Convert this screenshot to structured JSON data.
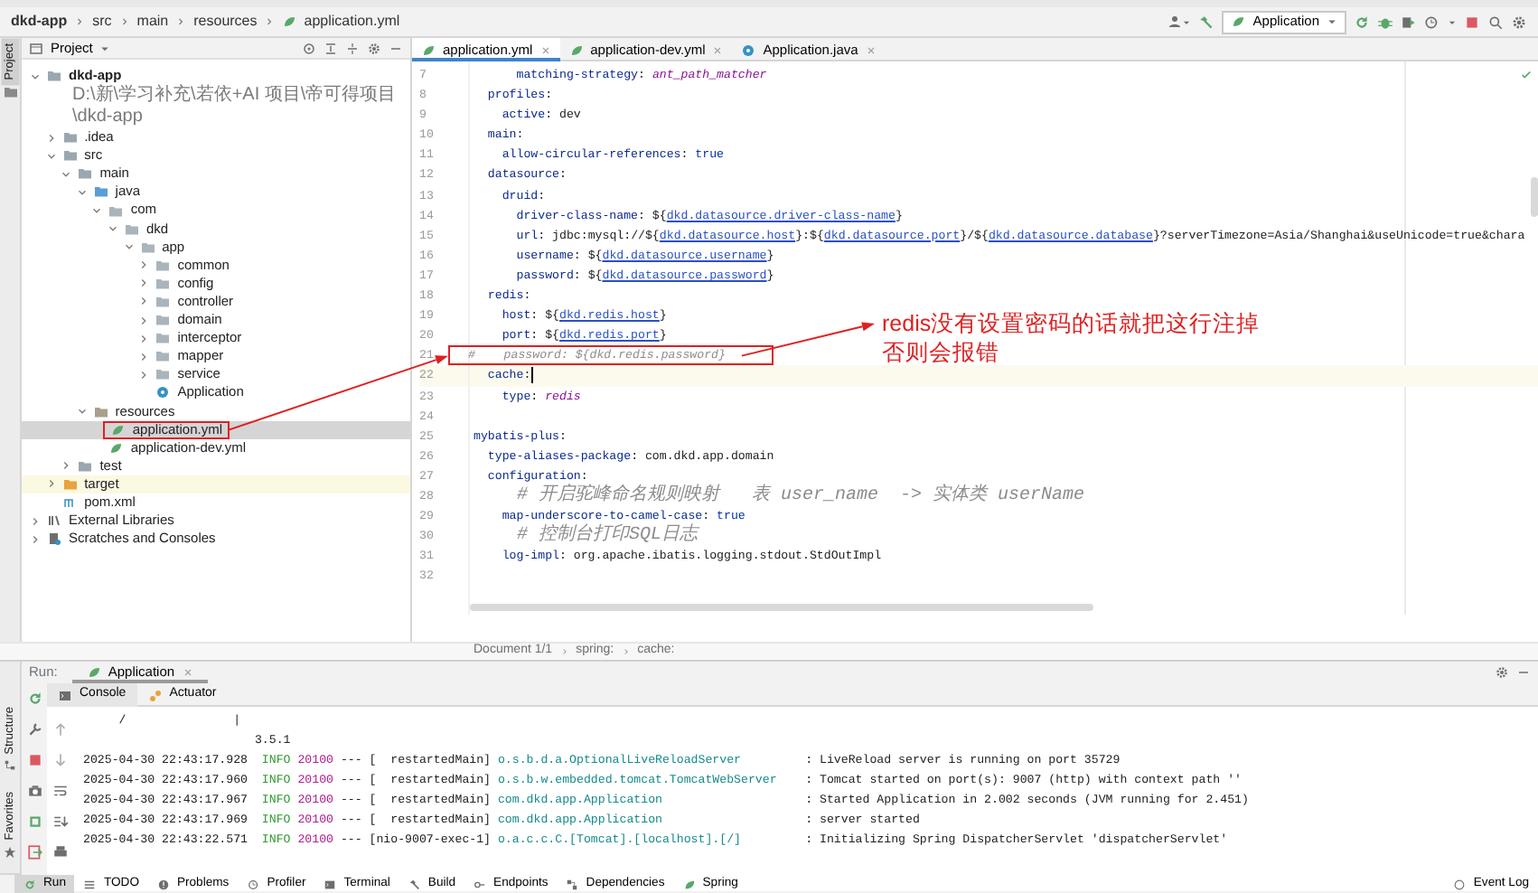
{
  "breadcrumb": [
    "dkd-app",
    "src",
    "main",
    "resources",
    "application.yml"
  ],
  "run_config": {
    "label": "Application"
  },
  "side_tabs": {
    "top": [
      {
        "label": "Project",
        "selected": true
      }
    ],
    "bottom": [
      {
        "label": "Structure",
        "selected": false
      },
      {
        "label": "Favorites",
        "selected": false
      }
    ]
  },
  "project_panel": {
    "title": "Project",
    "tree": [
      {
        "label": "dkd-app",
        "kind": "module",
        "path": "D:\\新\\学习补充\\若依+AI 项目\\帝可得项目\\dkd-app",
        "expanded": true,
        "selected": false,
        "children": [
          {
            "label": ".idea",
            "kind": "folder",
            "expanded": false,
            "selected": false
          },
          {
            "label": "src",
            "kind": "folder",
            "expanded": true,
            "selected": false,
            "children": [
              {
                "label": "main",
                "kind": "folder",
                "expanded": true,
                "selected": false,
                "children": [
                  {
                    "label": "java",
                    "kind": "source-root",
                    "expanded": true,
                    "selected": false,
                    "children": [
                      {
                        "label": "com",
                        "kind": "package",
                        "expanded": true,
                        "selected": false,
                        "children": [
                          {
                            "label": "dkd",
                            "kind": "package",
                            "expanded": true,
                            "selected": false,
                            "children": [
                              {
                                "label": "app",
                                "kind": "package",
                                "expanded": true,
                                "selected": false,
                                "children": [
                                  {
                                    "label": "common",
                                    "kind": "package",
                                    "expanded": false,
                                    "selected": false
                                  },
                                  {
                                    "label": "config",
                                    "kind": "package",
                                    "expanded": false,
                                    "selected": false
                                  },
                                  {
                                    "label": "controller",
                                    "kind": "package",
                                    "expanded": false,
                                    "selected": false
                                  },
                                  {
                                    "label": "domain",
                                    "kind": "package",
                                    "expanded": false,
                                    "selected": false
                                  },
                                  {
                                    "label": "interceptor",
                                    "kind": "package",
                                    "expanded": false,
                                    "selected": false
                                  },
                                  {
                                    "label": "mapper",
                                    "kind": "package",
                                    "expanded": false,
                                    "selected": false
                                  },
                                  {
                                    "label": "service",
                                    "kind": "package",
                                    "expanded": false,
                                    "selected": false
                                  },
                                  {
                                    "label": "Application",
                                    "kind": "class",
                                    "selected": false
                                  }
                                ]
                              }
                            ]
                          }
                        ]
                      }
                    ]
                  },
                  {
                    "label": "resources",
                    "kind": "resources",
                    "expanded": true,
                    "selected": false,
                    "children": [
                      {
                        "label": "application.yml",
                        "kind": "yml",
                        "selected": true,
                        "boxed": true
                      },
                      {
                        "label": "application-dev.yml",
                        "kind": "yml",
                        "selected": false
                      }
                    ]
                  }
                ]
              },
              {
                "label": "test",
                "kind": "folder",
                "expanded": false,
                "selected": false
              }
            ]
          },
          {
            "label": "target",
            "kind": "excluded",
            "expanded": false,
            "selected": false
          },
          {
            "label": "pom.xml",
            "kind": "maven",
            "selected": false
          }
        ]
      },
      {
        "label": "External Libraries",
        "kind": "libraries",
        "expanded": false,
        "selected": false
      },
      {
        "label": "Scratches and Consoles",
        "kind": "scratches",
        "expanded": false,
        "selected": false
      }
    ]
  },
  "editor": {
    "tabs": [
      {
        "label": "application.yml",
        "kind": "yml",
        "selected": true
      },
      {
        "label": "application-dev.yml",
        "kind": "yml",
        "selected": false
      },
      {
        "label": "Application.java",
        "kind": "class",
        "selected": false
      }
    ],
    "lines": [
      {
        "n": "7",
        "seg": [
          {
            "kind": "key",
            "text": "      matching-strategy"
          },
          {
            "kind": "plain",
            "text": ": "
          },
          {
            "kind": "italic",
            "text": "ant_path_matcher"
          }
        ]
      },
      {
        "n": "8",
        "seg": [
          {
            "kind": "key",
            "text": "  profiles"
          },
          {
            "kind": "plain",
            "text": ":"
          }
        ]
      },
      {
        "n": "9",
        "seg": [
          {
            "kind": "key",
            "text": "    active"
          },
          {
            "kind": "plain",
            "text": ": dev"
          }
        ]
      },
      {
        "n": "10",
        "seg": [
          {
            "kind": "key",
            "text": "  main"
          },
          {
            "kind": "plain",
            "text": ":"
          }
        ]
      },
      {
        "n": "11",
        "seg": [
          {
            "kind": "key",
            "text": "    allow-circular-references"
          },
          {
            "kind": "plain",
            "text": ": "
          },
          {
            "kind": "bool",
            "text": "true"
          }
        ]
      },
      {
        "n": "12",
        "seg": [
          {
            "kind": "key",
            "text": "  datasource"
          },
          {
            "kind": "plain",
            "text": ":"
          }
        ]
      },
      {
        "n": "13",
        "seg": [
          {
            "kind": "key",
            "text": "    druid"
          },
          {
            "kind": "plain",
            "text": ":"
          }
        ]
      },
      {
        "n": "14",
        "seg": [
          {
            "kind": "key",
            "text": "      driver-class-name"
          },
          {
            "kind": "plain",
            "text": ": ${"
          },
          {
            "kind": "ref",
            "text": "dkd.datasource.driver-class-name"
          },
          {
            "kind": "plain",
            "text": "}"
          }
        ]
      },
      {
        "n": "15",
        "seg": [
          {
            "kind": "key",
            "text": "      url"
          },
          {
            "kind": "plain",
            "text": ": jdbc:mysql://${"
          },
          {
            "kind": "ref",
            "text": "dkd.datasource.host"
          },
          {
            "kind": "plain",
            "text": "}:${"
          },
          {
            "kind": "ref",
            "text": "dkd.datasource.port"
          },
          {
            "kind": "plain",
            "text": "}/${"
          },
          {
            "kind": "ref",
            "text": "dkd.datasource.database"
          },
          {
            "kind": "plain",
            "text": "}?serverTimezone=Asia/Shanghai&useUnicode=true&chara"
          }
        ]
      },
      {
        "n": "16",
        "seg": [
          {
            "kind": "key",
            "text": "      username"
          },
          {
            "kind": "plain",
            "text": ": ${"
          },
          {
            "kind": "ref",
            "text": "dkd.datasource.username"
          },
          {
            "kind": "plain",
            "text": "}"
          }
        ]
      },
      {
        "n": "17",
        "seg": [
          {
            "kind": "key",
            "text": "      password"
          },
          {
            "kind": "plain",
            "text": ": ${"
          },
          {
            "kind": "ref",
            "text": "dkd.datasource.password"
          },
          {
            "kind": "plain",
            "text": "}"
          }
        ]
      },
      {
        "n": "18",
        "seg": [
          {
            "kind": "key",
            "text": "  redis"
          },
          {
            "kind": "plain",
            "text": ":"
          }
        ]
      },
      {
        "n": "19",
        "seg": [
          {
            "kind": "key",
            "text": "    host"
          },
          {
            "kind": "plain",
            "text": ": ${"
          },
          {
            "kind": "ref",
            "text": "dkd.redis.host"
          },
          {
            "kind": "plain",
            "text": "}"
          }
        ]
      },
      {
        "n": "20",
        "seg": [
          {
            "kind": "key",
            "text": "    port"
          },
          {
            "kind": "plain",
            "text": ": ${"
          },
          {
            "kind": "ref",
            "text": "dkd.redis.port"
          },
          {
            "kind": "plain",
            "text": "}"
          }
        ]
      },
      {
        "n": "21",
        "boxed": true,
        "seg": [
          {
            "kind": "comment",
            "text": "#    password: ${dkd.redis.password}"
          }
        ]
      },
      {
        "n": "22",
        "current": true,
        "seg": [
          {
            "kind": "key",
            "text": "  cache"
          },
          {
            "kind": "plain",
            "text": ":"
          }
        ]
      },
      {
        "n": "23",
        "seg": [
          {
            "kind": "key",
            "text": "    type"
          },
          {
            "kind": "plain",
            "text": ": "
          },
          {
            "kind": "italic",
            "text": "redis"
          }
        ]
      },
      {
        "n": "24"
      },
      {
        "n": "25",
        "seg": [
          {
            "kind": "key",
            "text": "mybatis-plus"
          },
          {
            "kind": "plain",
            "text": ":"
          }
        ]
      },
      {
        "n": "26",
        "seg": [
          {
            "kind": "key",
            "text": "  type-aliases-package"
          },
          {
            "kind": "plain",
            "text": ": com.dkd.app.domain"
          }
        ]
      },
      {
        "n": "27",
        "seg": [
          {
            "kind": "key",
            "text": "  configuration"
          },
          {
            "kind": "plain",
            "text": ":"
          }
        ]
      },
      {
        "n": "28",
        "seg": [
          {
            "kind": "cjk-comment",
            "text": "    # 开启驼峰命名规则映射   表 user_name  -> 实体类 userName"
          }
        ]
      },
      {
        "n": "29",
        "seg": [
          {
            "kind": "key",
            "text": "    map-underscore-to-camel-case"
          },
          {
            "kind": "plain",
            "text": ": "
          },
          {
            "kind": "bool",
            "text": "true"
          }
        ]
      },
      {
        "n": "30",
        "seg": [
          {
            "kind": "cjk-comment",
            "text": "    # 控制台打印SQL日志"
          }
        ]
      },
      {
        "n": "31",
        "seg": [
          {
            "kind": "key",
            "text": "    log-impl"
          },
          {
            "kind": "plain",
            "text": ": org.apache.ibatis.logging.stdout.StdOutImpl"
          }
        ]
      },
      {
        "n": "32"
      }
    ],
    "status": [
      "Document 1/1",
      "spring:",
      "cache:"
    ]
  },
  "annotation": {
    "lines": [
      "redis没有设置密码的话就把这行注掉",
      "否则会报错"
    ]
  },
  "run_panel": {
    "label": "Run:",
    "tabs": [
      {
        "label": "Application",
        "selected": true
      }
    ],
    "console_tabs": [
      {
        "label": "Console",
        "kind": "console",
        "selected": true
      },
      {
        "label": "Actuator",
        "kind": "actuator",
        "selected": false
      }
    ],
    "output": [
      {
        "kind": "banner",
        "text": "     /               |"
      },
      {
        "kind": "banner",
        "text": "                        3.5.1"
      },
      {
        "kind": "log",
        "time": "2025-04-30 22:43:17.928",
        "level": "INFO",
        "pid": "20100",
        "sep": "---",
        "thread": "[  restartedMain]",
        "logger": "o.s.b.d.a.OptionalLiveReloadServer",
        "message": ": LiveReload server is running on port 35729"
      },
      {
        "kind": "log",
        "time": "2025-04-30 22:43:17.960",
        "level": "INFO",
        "pid": "20100",
        "sep": "---",
        "thread": "[  restartedMain]",
        "logger": "o.s.b.w.embedded.tomcat.TomcatWebServer",
        "message": ": Tomcat started on port(s): 9007 (http) with context path ''"
      },
      {
        "kind": "log",
        "time": "2025-04-30 22:43:17.967",
        "level": "INFO",
        "pid": "20100",
        "sep": "---",
        "thread": "[  restartedMain]",
        "logger": "com.dkd.app.Application",
        "message": ": Started Application in 2.002 seconds (JVM running for 2.451)"
      },
      {
        "kind": "log",
        "time": "2025-04-30 22:43:17.969",
        "level": "INFO",
        "pid": "20100",
        "sep": "---",
        "thread": "[  restartedMain]",
        "logger": "com.dkd.app.Application",
        "message": ": server started"
      },
      {
        "kind": "log",
        "time": "2025-04-30 22:43:22.571",
        "level": "INFO",
        "pid": "20100",
        "sep": "---",
        "thread": "[nio-9007-exec-1]",
        "logger": "o.a.c.c.C.[Tomcat].[localhost].[/]",
        "message": ": Initializing Spring DispatcherServlet 'dispatcherServlet'"
      }
    ]
  },
  "tool_windows": [
    {
      "label": "Run",
      "kind": "run",
      "selected": true
    },
    {
      "label": "TODO",
      "kind": "todo",
      "selected": false
    },
    {
      "label": "Problems",
      "kind": "problems",
      "selected": false
    },
    {
      "label": "Profiler",
      "kind": "profiler",
      "selected": false
    },
    {
      "label": "Terminal",
      "kind": "terminal",
      "selected": false
    },
    {
      "label": "Build",
      "kind": "build",
      "selected": false
    },
    {
      "label": "Endpoints",
      "kind": "endpoints",
      "selected": false
    },
    {
      "label": "Dependencies",
      "kind": "dependencies",
      "selected": false
    },
    {
      "label": "Spring",
      "kind": "spring",
      "selected": false
    }
  ],
  "event_log": "Event Log"
}
